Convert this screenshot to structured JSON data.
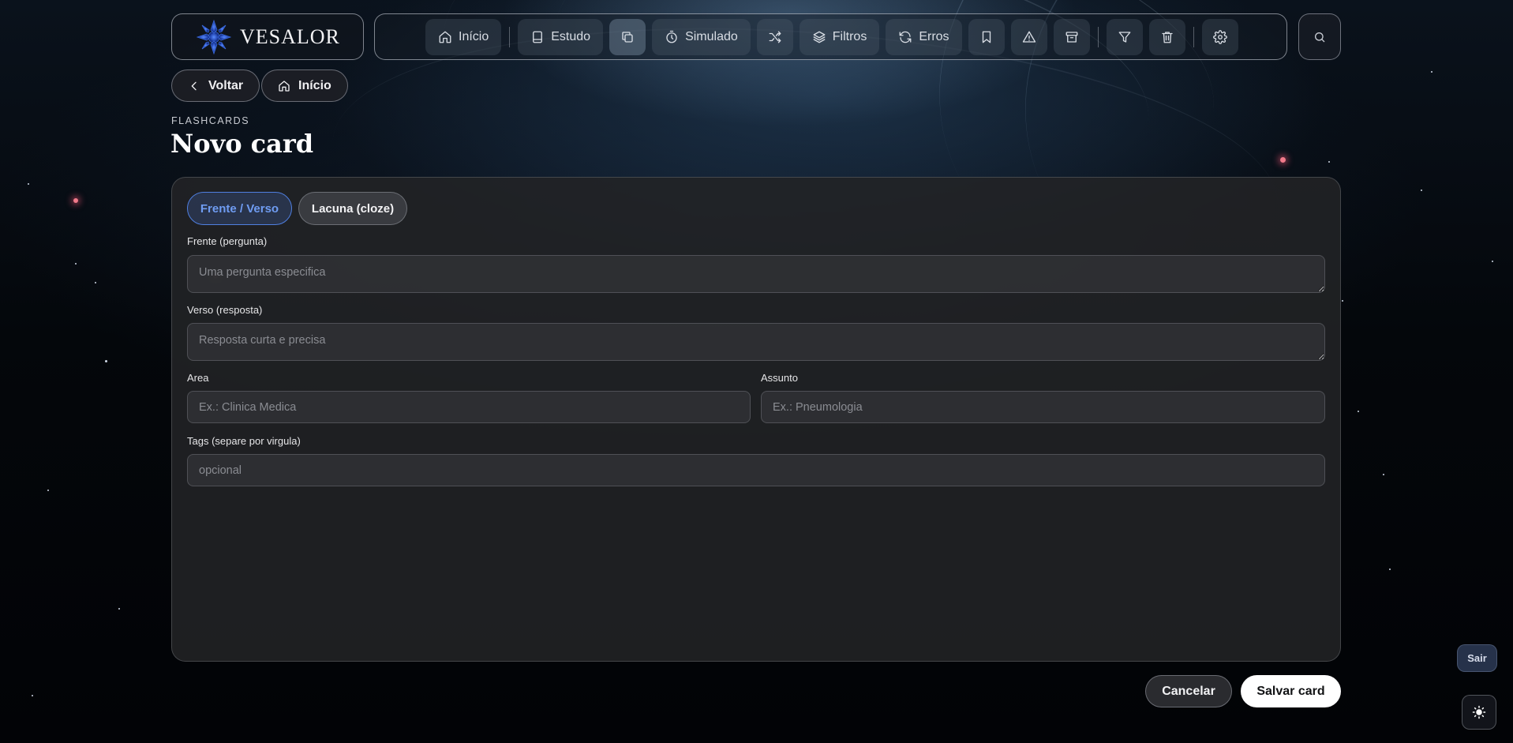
{
  "brand": {
    "name": "VESALOR"
  },
  "nav": {
    "inicio": "Início",
    "estudo": "Estudo",
    "simulado": "Simulado",
    "filtros": "Filtros",
    "erros": "Erros",
    "active": "flashcards"
  },
  "actions": {
    "back": "Voltar",
    "home": "Início"
  },
  "page": {
    "kicker": "FLASHCARDS",
    "title": "Novo card"
  },
  "form": {
    "mode_tabs": [
      "Frente / Verso",
      "Lacuna (cloze)"
    ],
    "selected_mode": "Frente / Verso",
    "front": {
      "label": "Frente (pergunta)",
      "placeholder": "Uma pergunta especifica",
      "value": ""
    },
    "back": {
      "label": "Verso (resposta)",
      "placeholder": "Resposta curta e precisa",
      "value": ""
    },
    "area": {
      "label": "Area",
      "placeholder": "Ex.: Clinica Medica",
      "value": ""
    },
    "subject": {
      "label": "Assunto",
      "placeholder": "Ex.: Pneumologia",
      "value": ""
    },
    "tags": {
      "label": "Tags (separe por virgula)",
      "placeholder": "opcional",
      "value": ""
    }
  },
  "footer": {
    "cancel": "Cancelar",
    "save": "Salvar card",
    "exit": "Sair"
  },
  "colors": {
    "accent": "#4f7fe0",
    "background": "#020306",
    "card": "#222326"
  }
}
